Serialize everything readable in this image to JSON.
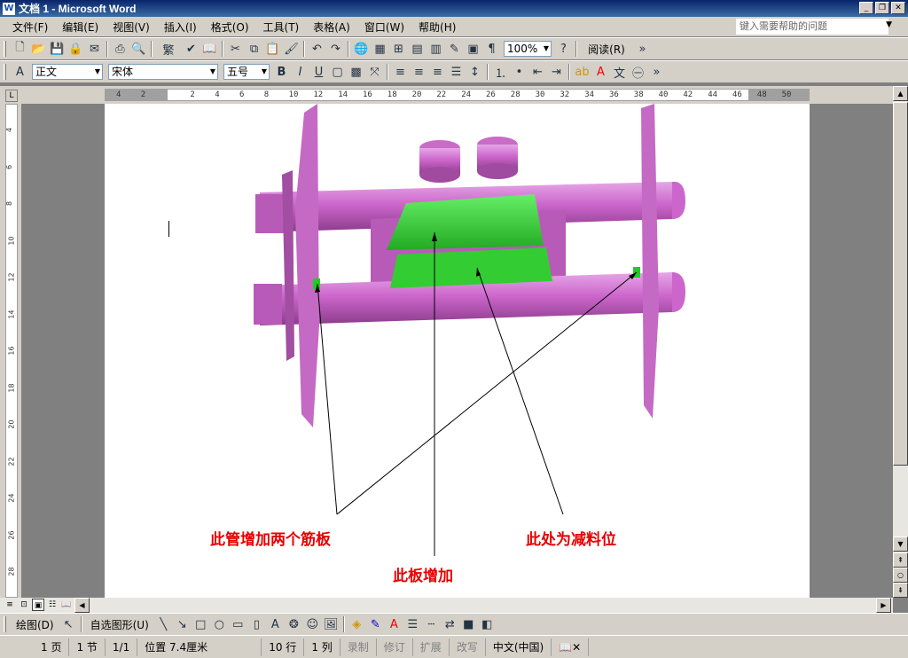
{
  "window": {
    "title": "文档 1 - Microsoft Word",
    "app_icon": "W"
  },
  "menubar": {
    "items": [
      "文件(F)",
      "编辑(E)",
      "视图(V)",
      "插入(I)",
      "格式(O)",
      "工具(T)",
      "表格(A)",
      "窗口(W)",
      "帮助(H)"
    ],
    "help_placeholder": "键入需要帮助的问题"
  },
  "toolbar": {
    "zoom": "100%",
    "read": "阅读(R)",
    "traditional": "繁"
  },
  "format": {
    "style": "正文",
    "font": "宋体",
    "size": "五号"
  },
  "ruler": {
    "h_ticks": [
      "4",
      "2",
      "",
      "2",
      "4",
      "6",
      "8",
      "10",
      "12",
      "14",
      "16",
      "18",
      "20",
      "22",
      "24",
      "26",
      "28",
      "30",
      "32",
      "34",
      "36",
      "38",
      "40",
      "42",
      "44",
      "46",
      "48",
      "50"
    ],
    "v_ticks": [
      "4",
      "6",
      "8",
      "10",
      "12",
      "14",
      "16",
      "18",
      "20",
      "22",
      "24",
      "26",
      "28"
    ]
  },
  "document": {
    "annotations": [
      "此管增加两个筋板",
      "此处为减料位",
      "此板增加"
    ]
  },
  "drawbar": {
    "draw": "绘图(D)",
    "autoshapes": "自选图形(U)"
  },
  "status": {
    "page": "1 页",
    "section": "1 节",
    "pages": "1/1",
    "position": "位置 7.4厘米",
    "line": "10 行",
    "col": "1 列",
    "rec": "录制",
    "trk": "修订",
    "ext": "扩展",
    "ovr": "改写",
    "lang": "中文(中国)"
  },
  "colors": {
    "model": "#cc66cc",
    "plate": "#33dd33",
    "annotation": "#e60000"
  }
}
